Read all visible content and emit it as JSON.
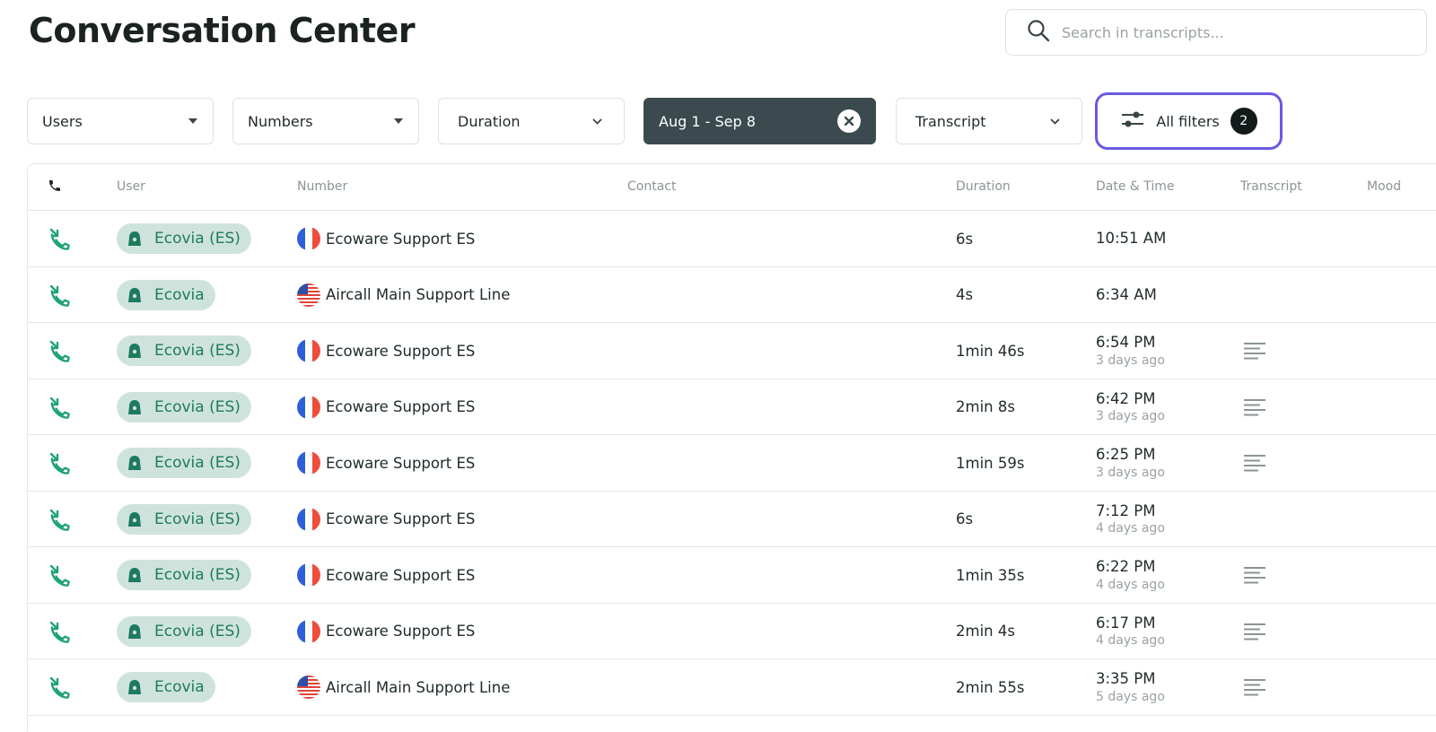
{
  "header": {
    "title": "Conversation Center",
    "search_placeholder": "Search in transcripts..."
  },
  "filters": {
    "users": "Users",
    "numbers": "Numbers",
    "duration": "Duration",
    "date_range": "Aug 1 - Sep 8",
    "transcript": "Transcript",
    "all_filters": "All filters",
    "all_filters_count": "2"
  },
  "colors": {
    "accent_outline": "#6a5ae0",
    "active_filter_bg": "#3a4a4f",
    "chip_bg": "#cfe3dd",
    "chip_text": "#1e7a5e",
    "call_icon": "#1fa27a"
  },
  "table": {
    "columns": {
      "direction": "phone-icon",
      "user": "User",
      "number": "Number",
      "contact": "Contact",
      "duration": "Duration",
      "datetime": "Date & Time",
      "transcript": "Transcript",
      "mood": "Mood"
    },
    "rows": [
      {
        "user": "Ecovia (ES)",
        "flag": "fr",
        "number": "Ecoware Support ES",
        "duration": "6s",
        "time": "10:51 AM",
        "ago": "",
        "transcript": false
      },
      {
        "user": "Ecovia",
        "flag": "us",
        "number": "Aircall Main Support Line",
        "duration": "4s",
        "time": "6:34 AM",
        "ago": "",
        "transcript": false
      },
      {
        "user": "Ecovia (ES)",
        "flag": "fr",
        "number": "Ecoware Support ES",
        "duration": "1min 46s",
        "time": "6:54 PM",
        "ago": "3 days ago",
        "transcript": true
      },
      {
        "user": "Ecovia (ES)",
        "flag": "fr",
        "number": "Ecoware Support ES",
        "duration": "2min 8s",
        "time": "6:42 PM",
        "ago": "3 days ago",
        "transcript": true
      },
      {
        "user": "Ecovia (ES)",
        "flag": "fr",
        "number": "Ecoware Support ES",
        "duration": "1min 59s",
        "time": "6:25 PM",
        "ago": "3 days ago",
        "transcript": true
      },
      {
        "user": "Ecovia (ES)",
        "flag": "fr",
        "number": "Ecoware Support ES",
        "duration": "6s",
        "time": "7:12 PM",
        "ago": "4 days ago",
        "transcript": false
      },
      {
        "user": "Ecovia (ES)",
        "flag": "fr",
        "number": "Ecoware Support ES",
        "duration": "1min 35s",
        "time": "6:22 PM",
        "ago": "4 days ago",
        "transcript": true
      },
      {
        "user": "Ecovia (ES)",
        "flag": "fr",
        "number": "Ecoware Support ES",
        "duration": "2min 4s",
        "time": "6:17 PM",
        "ago": "4 days ago",
        "transcript": true
      },
      {
        "user": "Ecovia",
        "flag": "us",
        "number": "Aircall Main Support Line",
        "duration": "2min 55s",
        "time": "3:35 PM",
        "ago": "5 days ago",
        "transcript": true
      }
    ]
  }
}
